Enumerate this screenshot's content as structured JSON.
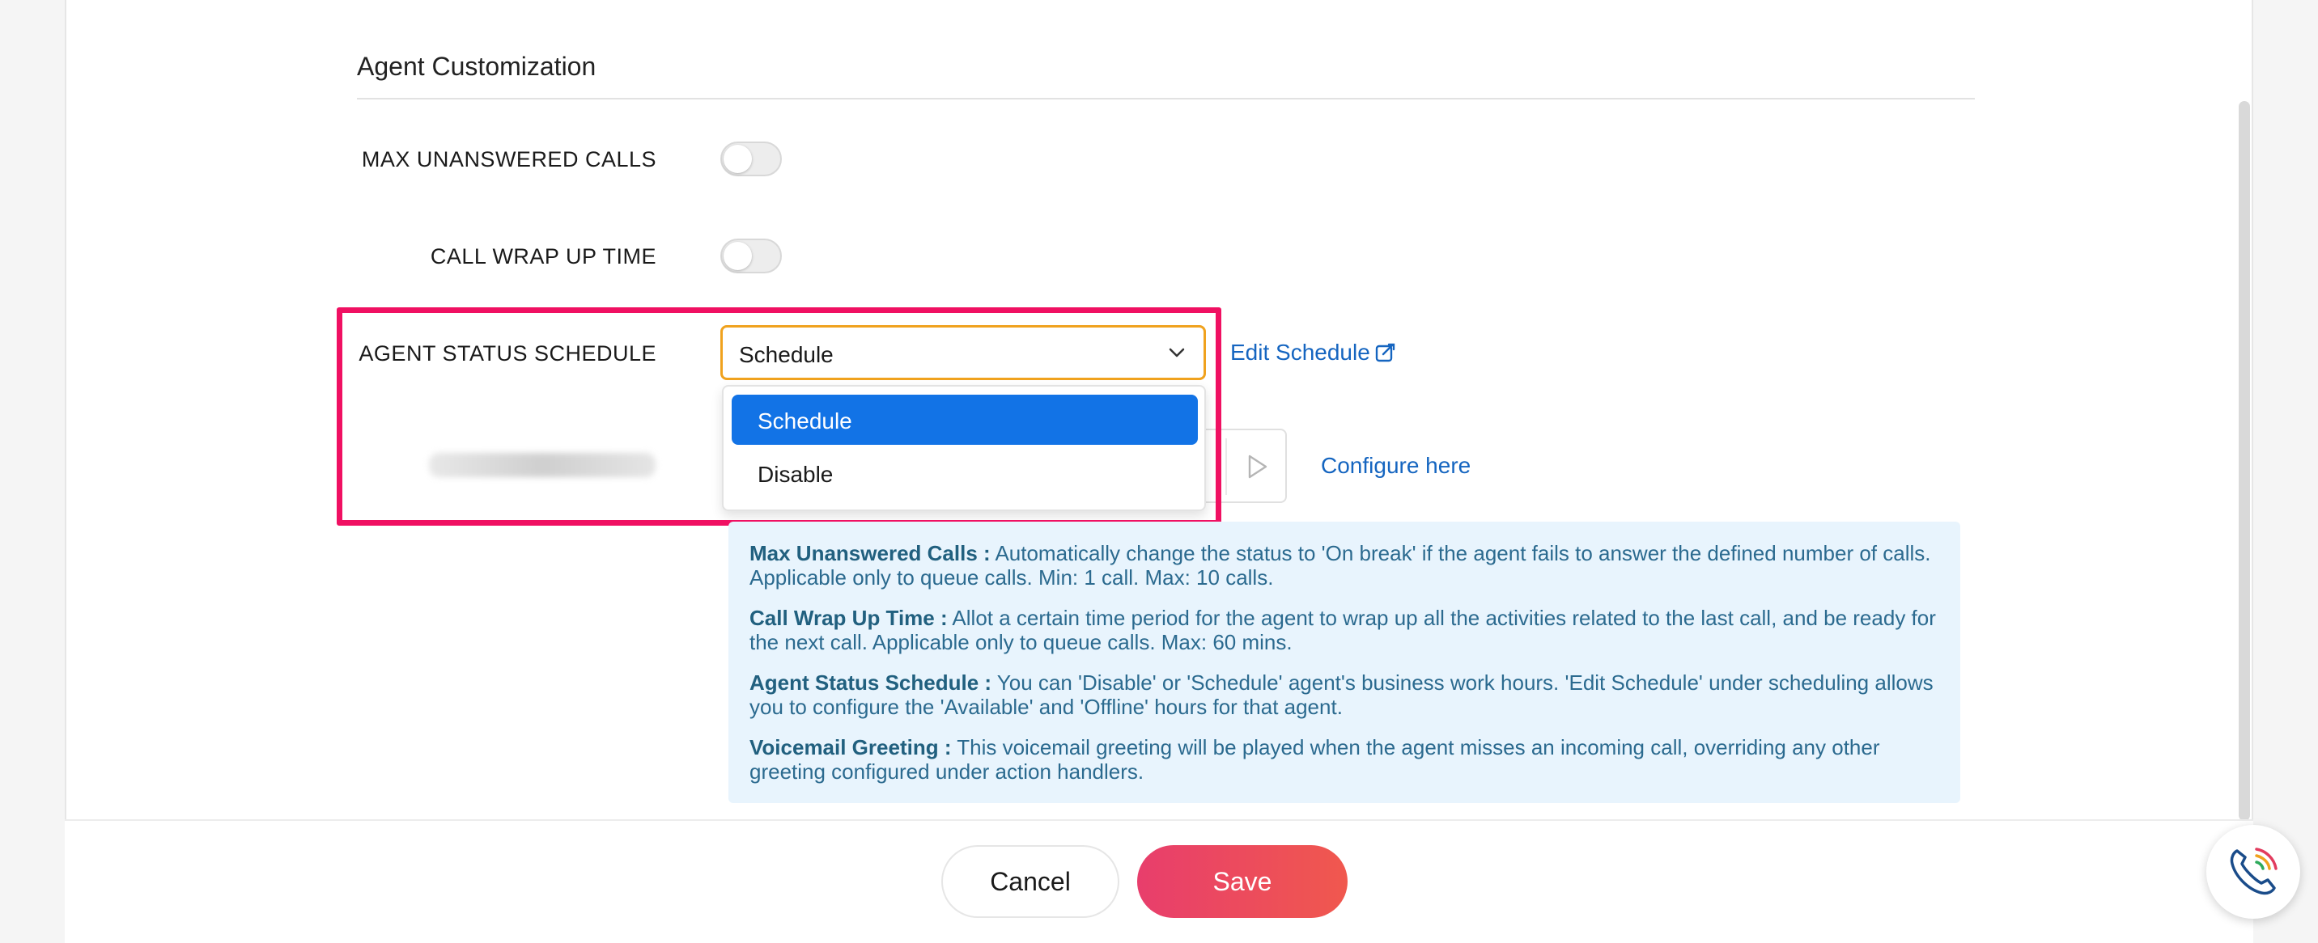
{
  "section": {
    "title": "Agent Customization"
  },
  "fields": {
    "max_unanswered": {
      "label": "MAX UNANSWERED CALLS",
      "enabled": false
    },
    "wrap_up": {
      "label": "CALL WRAP UP TIME",
      "enabled": false
    },
    "status_schedule": {
      "label": "AGENT STATUS SCHEDULE",
      "selected": "Schedule",
      "options": [
        "Schedule",
        "Disable"
      ],
      "edit_link": "Edit Schedule"
    },
    "voicemail": {
      "configure_link": "Configure here"
    }
  },
  "info": [
    {
      "title": "Max Unanswered Calls :",
      "text": " Automatically change the status to 'On break' if the agent fails to answer the defined number of calls. Applicable only to queue calls. Min: 1 call. Max: 10 calls."
    },
    {
      "title": "Call Wrap Up Time :",
      "text": " Allot a certain time period for the agent to wrap up all the activities related to the last call, and be ready for the next call. Applicable only to queue calls. Max: 60 mins."
    },
    {
      "title": "Agent Status Schedule :",
      "text": " You can 'Disable' or 'Schedule' agent's business work hours. 'Edit Schedule' under scheduling allows you to configure the 'Available' and 'Offline' hours for that agent."
    },
    {
      "title": "Voicemail Greeting :",
      "text": " This voicemail greeting will be played when the agent misses an incoming call, overriding any other greeting configured under action handlers."
    }
  ],
  "footer": {
    "cancel_label": "Cancel",
    "save_label": "Save"
  },
  "colors": {
    "accent": "#1273e6",
    "link": "#1565c0",
    "highlight": "#f01062",
    "save": "#e83e6c",
    "focus": "#f0a21e"
  },
  "icons": {
    "chevron": "chevron-down-icon",
    "edit": "external-edit-icon",
    "play": "play-icon",
    "phone": "phone-call-icon"
  }
}
